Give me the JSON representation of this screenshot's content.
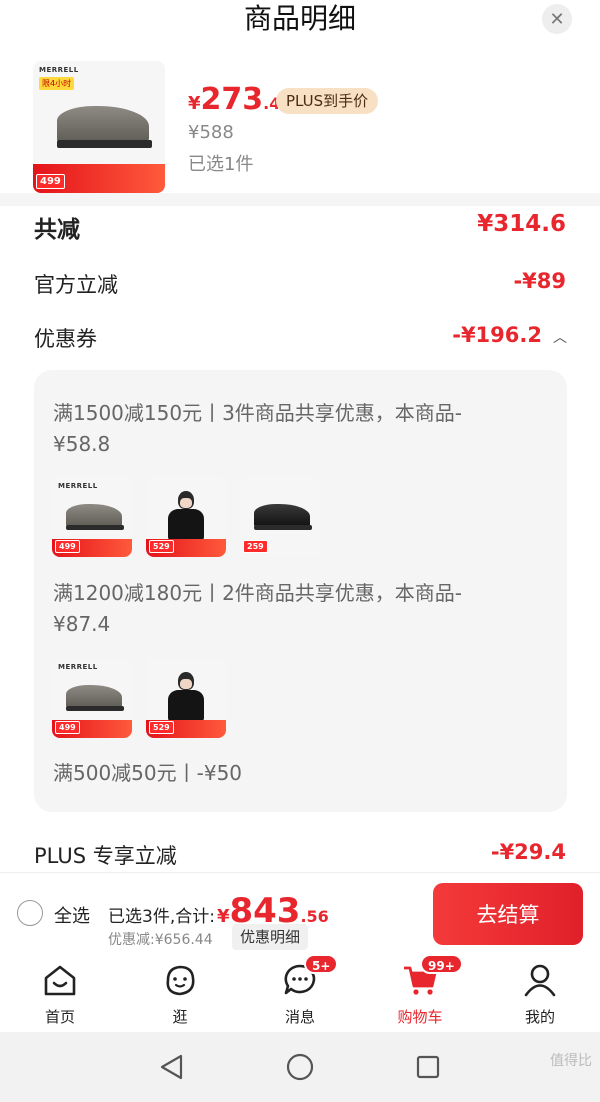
{
  "sheet": {
    "title": "商品明细",
    "close_icon": "close-icon"
  },
  "product": {
    "price_symbol": "¥",
    "price_int": "273",
    "price_dec": ".4",
    "plus_tag": "PLUS到手价",
    "original_price": "¥588",
    "selected": "已选1件",
    "thumb": {
      "brand": "MERRELL",
      "tag": "限4小时",
      "price_badge": "499"
    }
  },
  "summary": {
    "total_reduction_label": "共减",
    "total_reduction_value": "¥314.6",
    "official_label": "官方立减",
    "official_value": "-¥89",
    "coupon_label": "优惠券",
    "coupon_value": "-¥196.2"
  },
  "coupons": [
    {
      "text": "满1500减150元丨3件商品共享优惠，本商品-¥58.8",
      "thumbs": [
        {
          "type": "shoe",
          "badge": "499"
        },
        {
          "type": "person",
          "badge": "529"
        },
        {
          "type": "dark-shoe",
          "badge": "259"
        }
      ]
    },
    {
      "text": "满1200减180元丨2件商品共享优惠，本商品-¥87.4",
      "thumbs": [
        {
          "type": "shoe",
          "badge": "499"
        },
        {
          "type": "person",
          "badge": "529"
        }
      ]
    },
    {
      "text": "满500减50元丨-¥50",
      "thumbs": []
    }
  ],
  "plus": {
    "label": "PLUS 专享立减",
    "value": "-¥29.4"
  },
  "bottom_bar": {
    "select_all": "全选",
    "total_prefix": "已选3件,合计:",
    "total_symbol": "¥",
    "total_int": "843",
    "total_dec": ".56",
    "discount_note": "优惠减:¥656.44",
    "detail_chip": "优惠明细",
    "checkout": "去结算"
  },
  "tabs": [
    {
      "label": "首页",
      "icon": "home-icon"
    },
    {
      "label": "逛",
      "icon": "explore-icon"
    },
    {
      "label": "消息",
      "icon": "message-icon",
      "badge": "5+"
    },
    {
      "label": "购物车",
      "icon": "cart-icon",
      "badge": "99+",
      "active": true
    },
    {
      "label": "我的",
      "icon": "profile-icon"
    }
  ],
  "watermark": "值得比",
  "colors": {
    "accent": "#e8262d",
    "plus_tag_bg": "#f8e0c4",
    "panel": "#f5f5f5"
  }
}
